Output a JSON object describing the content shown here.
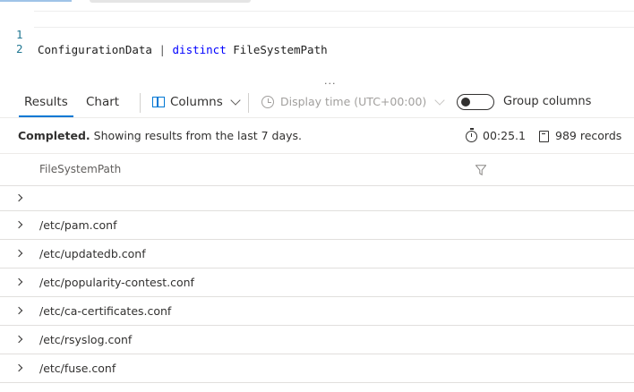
{
  "editor": {
    "lines": [
      {
        "number": "1",
        "tokens": {
          "table": "ConfigurationData",
          "pipe": " | ",
          "keyword": "distinct",
          "column": " FileSystemPath"
        }
      },
      {
        "number": "2"
      }
    ]
  },
  "splitter": "...",
  "tabs": {
    "results": "Results",
    "chart": "Chart"
  },
  "toolbar": {
    "columns_label": "Columns",
    "display_time_label": "Display time (UTC+00:00)",
    "group_columns_label": "Group columns",
    "group_columns_on": false
  },
  "status": {
    "completed": "Completed.",
    "message": " Showing results from the last 7 days.",
    "duration": "00:25.1",
    "records": "989 records"
  },
  "table": {
    "column": "FileSystemPath",
    "rows": [
      "",
      "/etc/pam.conf",
      "/etc/updatedb.conf",
      "/etc/popularity-contest.conf",
      "/etc/ca-certificates.conf",
      "/etc/rsyslog.conf",
      "/etc/fuse.conf"
    ]
  },
  "icons": {
    "columns": "columns-icon",
    "clock": "clock-icon",
    "stopwatch": "stopwatch-icon",
    "records": "records-icon",
    "filter": "filter-icon",
    "expand": "chevron-right-icon"
  },
  "colors": {
    "accent": "#0078d4",
    "keyword": "#0000ff",
    "line_number": "#237893"
  }
}
